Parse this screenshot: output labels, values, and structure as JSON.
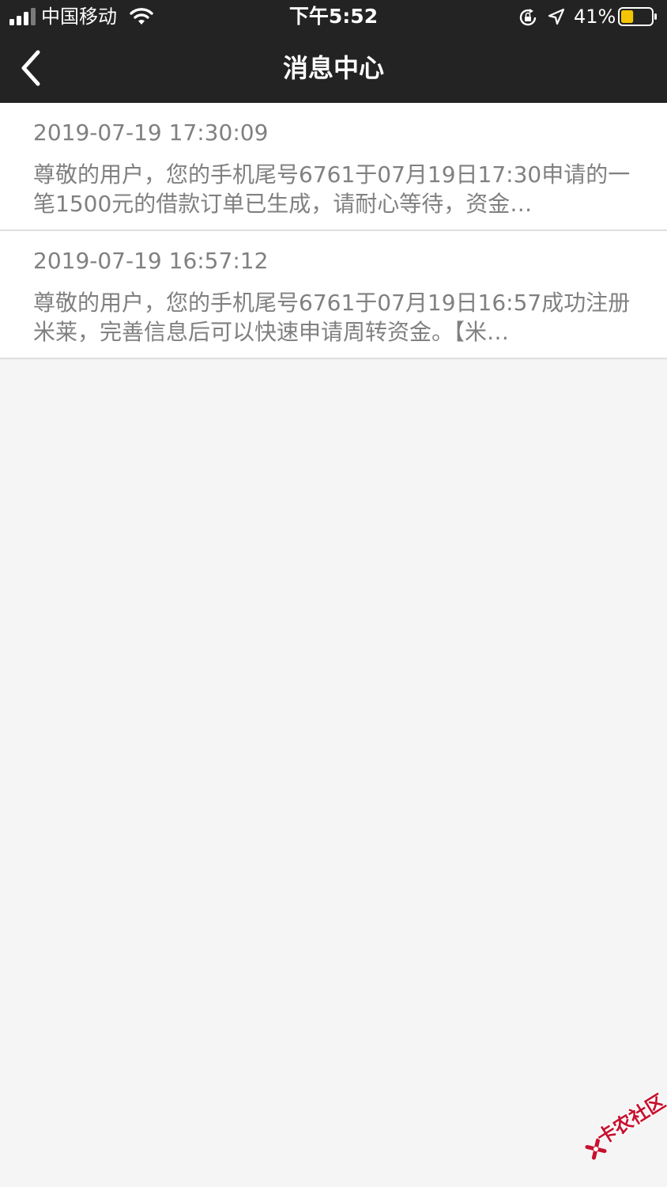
{
  "status_bar": {
    "carrier": "中国移动",
    "time": "下午5:52",
    "battery_percent": "41%",
    "battery_level": 0.41,
    "battery_color": "#f5c400",
    "icons": [
      "signal-icon",
      "wifi-icon",
      "rotation-lock-icon",
      "location-arrow-icon",
      "battery-icon"
    ]
  },
  "nav": {
    "title": "消息中心",
    "back_icon": "chevron-left-icon",
    "background_color": "#232323"
  },
  "messages": [
    {
      "timestamp": "2019-07-19 17:30:09",
      "body": "尊敬的用户，您的手机尾号6761于07月19日17:30申请的一笔1500元的借款订单已生成，请耐心等待，资金…"
    },
    {
      "timestamp": "2019-07-19 16:57:12",
      "body": "尊敬的用户，您的手机尾号6761于07月19日16:57成功注册米莱，完善信息后可以快速申请周转资金。【米…"
    }
  ],
  "watermark": {
    "text": "卡农社区",
    "color": "#c8102e"
  }
}
